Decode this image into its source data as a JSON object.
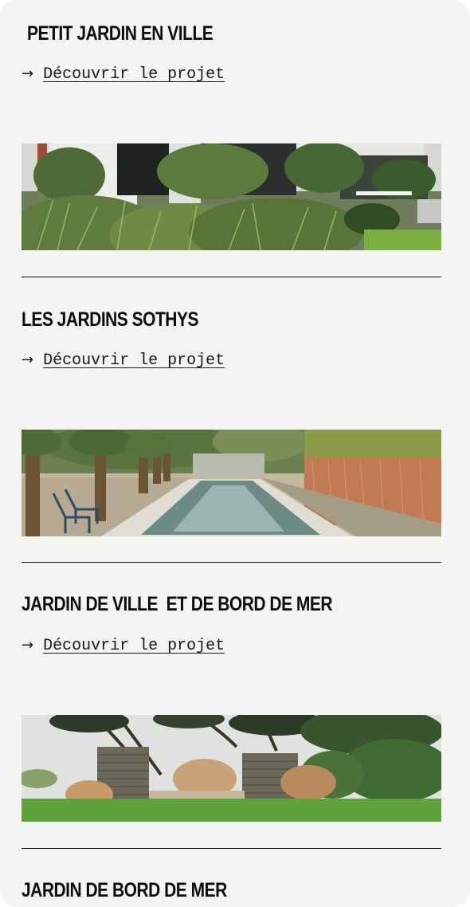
{
  "projects": [
    {
      "title": "PETIT JARDIN EN VILLE",
      "link_label": "Découvrir le projet",
      "image_alt": "Jardin avec graminées devant une maison blanche"
    },
    {
      "title": "LES JARDINS SOTHYS",
      "link_label": "Découvrir le projet",
      "image_alt": "Bassin miroir bordé de palmiers et de graminées"
    },
    {
      "title": "JARDIN DE VILLE  ET DE BORD DE MER",
      "link_label": "Découvrir le projet",
      "image_alt": "Jardin avec murets de pierre et pins"
    },
    {
      "title": "JARDIN DE BORD DE MER"
    }
  ],
  "link_arrow": "→",
  "colors": {
    "background": "#f4f4f2",
    "text": "#0c0c0c",
    "divider": "#111111"
  },
  "icons": [
    "arrow-right-icon"
  ]
}
